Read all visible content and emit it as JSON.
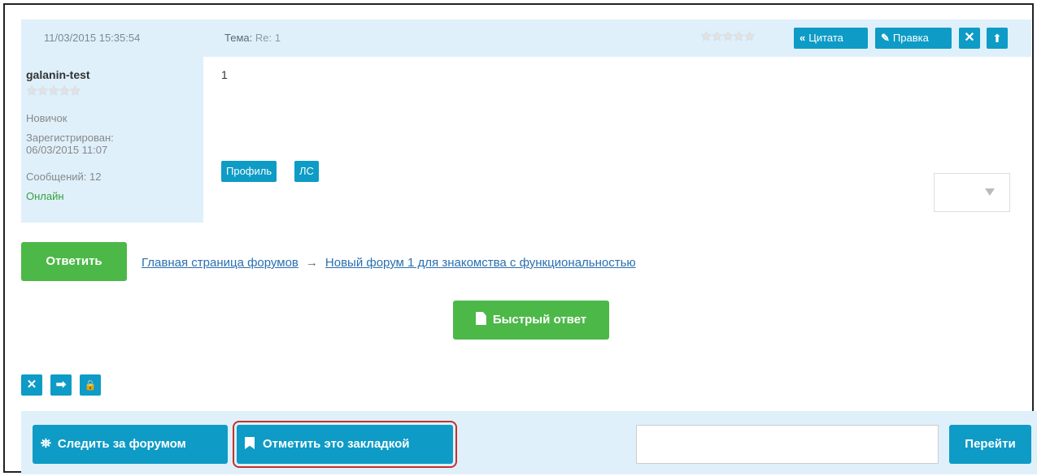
{
  "post": {
    "date": "11/03/2015 15:35:54",
    "topic_label": "Тема:",
    "topic_value": "Re: 1",
    "rating_stars": "★★★★★",
    "quote_label": "Цитата",
    "edit_label": "Правка",
    "delete_glyph": "✕",
    "up_glyph": "⬆",
    "body": "1",
    "profile_label": "Профиль",
    "pm_label": "ЛС",
    "select_value": ""
  },
  "user": {
    "name": "galanin-test",
    "stars": "★★★★★",
    "rank": "Новичок",
    "registered_label": "Зарегистрирован:",
    "registered_date": "06/03/2015 11:07",
    "messages": "Сообщений: 12",
    "status": "Онлайн"
  },
  "actions": {
    "reply_label": "Ответить",
    "quick_reply_label": "Быстрый ответ"
  },
  "breadcrumb": {
    "home": "Главная страница форумов",
    "separator": "→",
    "forum": "Новый форум 1 для знакомства с функциональностью"
  },
  "mod_tools": {
    "delete_glyph": "✕",
    "move_glyph": "➡",
    "lock_glyph": "🔒"
  },
  "bottom": {
    "follow_label": "Следить за форумом",
    "bookmark_label": "Отметить это закладкой",
    "goto_value": "",
    "goto_label": "Перейти"
  },
  "colors": {
    "accent": "#0e9bc6",
    "green": "#4cb848",
    "panel_bg": "#dff0fb",
    "highlight": "#c4312b"
  }
}
